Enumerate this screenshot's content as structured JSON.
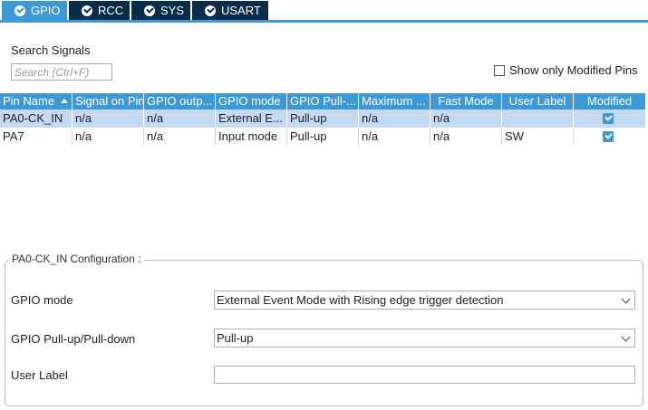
{
  "tabs": [
    {
      "label": "GPIO",
      "active": true
    },
    {
      "label": "RCC",
      "active": false
    },
    {
      "label": "SYS",
      "active": false
    },
    {
      "label": "USART",
      "active": false
    }
  ],
  "search": {
    "label": "Search Signals",
    "placeholder": "Search (Ctrl+F)",
    "value": ""
  },
  "show_modified": {
    "label": "Show only Modified Pins",
    "checked": false
  },
  "table": {
    "columns": [
      "Pin Name",
      "Signal on Pin",
      "GPIO outp...",
      "GPIO mode",
      "GPIO Pull-...",
      "Maximum ...",
      "Fast Mode",
      "User Label",
      "Modified"
    ],
    "rows": [
      {
        "pin": "PA0-CK_IN",
        "signal": "n/a",
        "output": "n/a",
        "mode": "External E...",
        "pull": "Pull-up",
        "maximum": "n/a",
        "fast": "n/a",
        "label": "",
        "modified": true,
        "selected": true
      },
      {
        "pin": "PA7",
        "signal": "n/a",
        "output": "n/a",
        "mode": "Input mode",
        "pull": "Pull-up",
        "maximum": "n/a",
        "fast": "n/a",
        "label": "SW",
        "modified": true,
        "selected": false
      }
    ]
  },
  "config": {
    "title": "PA0-CK_IN Configuration :",
    "gpio_mode_label": "GPIO mode",
    "gpio_mode_value": "External Event Mode with Rising edge trigger detection",
    "pull_label": "GPIO Pull-up/Pull-down",
    "pull_value": "Pull-up",
    "user_label_label": "User Label",
    "user_label_value": ""
  },
  "colors": {
    "accent": "#3e98d4",
    "tab_dark": "#0b2d49",
    "selected_row": "#c5d9f1"
  }
}
